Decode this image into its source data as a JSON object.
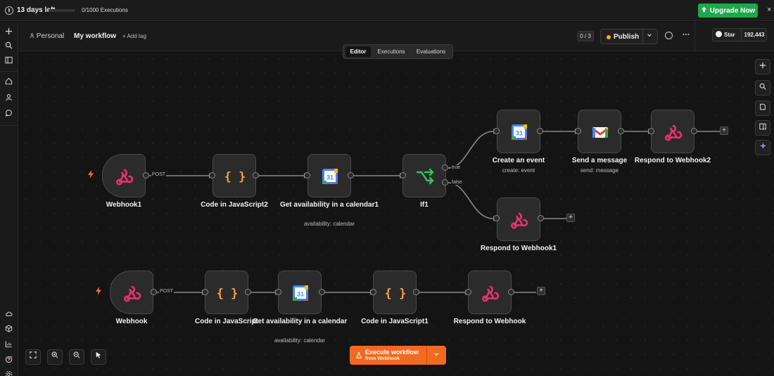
{
  "banner": {
    "days_left": "13 days left",
    "executions": "0/1000 Executions",
    "execution_progress": 0.05,
    "upgrade_label": "Upgrade Now",
    "close_icon": "×"
  },
  "header": {
    "project": "Personal",
    "workflow_name": "My workflow",
    "add_tag": "+ Add tag",
    "counter": "0 / 3",
    "publish_label": "Publish",
    "github_star": "Star",
    "github_count": "192,443"
  },
  "tabs": [
    "Editor",
    "Executions",
    "Evaluations"
  ],
  "nodes": {
    "webhook1": {
      "label": "Webhook1"
    },
    "code_js2": {
      "label": "Code in JavaScript2"
    },
    "get_avail1": {
      "label": "Get availability in a calendar1",
      "sub": "availability: calendar"
    },
    "if1": {
      "label": "If1"
    },
    "create_event": {
      "label": "Create an event",
      "sub": "create: event"
    },
    "send_message": {
      "label": "Send a message",
      "sub": "send: message"
    },
    "respond2": {
      "label": "Respond to Webhook2"
    },
    "respond1": {
      "label": "Respond to Webhook1"
    },
    "webhook": {
      "label": "Webhook"
    },
    "code_js": {
      "label": "Code in JavaScript"
    },
    "get_avail": {
      "label": "Get availability in a calendar",
      "sub": "availability: calendar"
    },
    "code_js1": {
      "label": "Code in JavaScript1"
    },
    "respond": {
      "label": "Respond to Webhook"
    }
  },
  "edge_labels": {
    "post1": "POST",
    "post2": "POST",
    "true": "true",
    "false": "false"
  },
  "execute": {
    "label": "Execute workflow",
    "sub": "from Webhook"
  },
  "icons": {
    "code": "{ }",
    "calendar_day": "31",
    "plus": "+"
  },
  "colors": {
    "accent_orange": "#f26b1d",
    "upgrade_green": "#1ea84a",
    "webhook_pink": "#e8326e",
    "code_orange": "#f0a04b",
    "if_green": "#33c46a"
  }
}
